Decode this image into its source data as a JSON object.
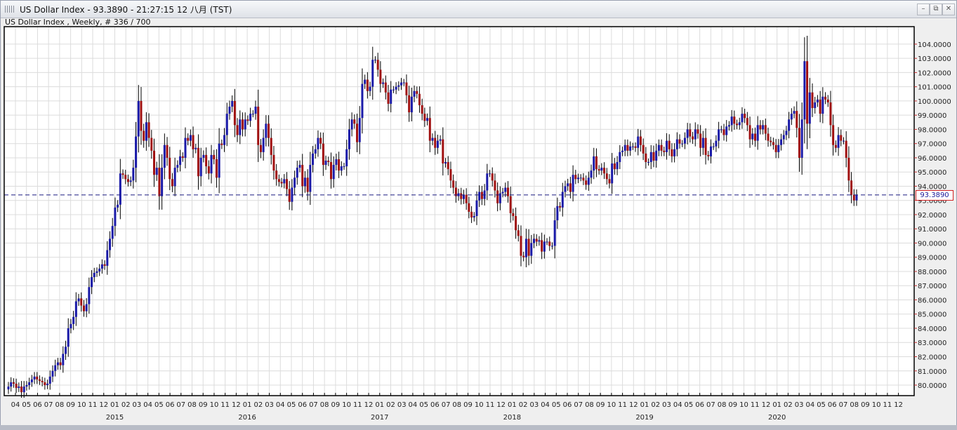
{
  "window": {
    "title": "US Dollar Index - 93.3890 - 21:27:15  12 八月 (TST)",
    "icon": "chart-grid-icon",
    "buttons": {
      "minimize": "–",
      "restore": "⧉",
      "close": "✕"
    }
  },
  "subtitle": "US Dollar Index , Weekly, # 336 / 700",
  "colors": {
    "up": "#1a1aa8",
    "down": "#a01010",
    "wick": "#000000",
    "current_line": "#1a1a80",
    "grid": "#dcdcdc"
  },
  "chart_data": {
    "type": "candlestick",
    "title": "US Dollar Index",
    "period": "Weekly",
    "current_price": 93.389,
    "current_price_label": "93.3890",
    "ylim": [
      79.26,
      105.23
    ],
    "y_ticks": [
      "80.0000",
      "81.0000",
      "82.0000",
      "83.0000",
      "84.0000",
      "85.0000",
      "86.0000",
      "87.0000",
      "88.0000",
      "89.0000",
      "90.0000",
      "91.0000",
      "92.0000",
      "93.0000",
      "94.0000",
      "95.0000",
      "96.0000",
      "97.0000",
      "98.0000",
      "99.0000",
      "100.0000",
      "101.0000",
      "102.0000",
      "103.0000",
      "104.0000"
    ],
    "month_labels": [
      "04",
      "05",
      "06",
      "07",
      "08",
      "09",
      "10",
      "11",
      "12",
      "01",
      "02",
      "03",
      "04",
      "05",
      "06",
      "07",
      "08",
      "09",
      "10",
      "11",
      "12",
      "01",
      "02",
      "03",
      "04",
      "05",
      "06",
      "07",
      "08",
      "09",
      "10",
      "11",
      "12",
      "01",
      "02",
      "03",
      "04",
      "05",
      "06",
      "07",
      "08",
      "09",
      "10",
      "11",
      "12",
      "01",
      "02",
      "03",
      "04",
      "05",
      "06",
      "07",
      "08",
      "09",
      "10",
      "11",
      "12",
      "01",
      "02",
      "03",
      "04",
      "05",
      "06",
      "07",
      "08",
      "09",
      "10",
      "11",
      "12",
      "01",
      "02",
      "03",
      "04",
      "05",
      "06",
      "07",
      "08",
      "09",
      "10",
      "11",
      "12"
    ],
    "year_labels": [
      "2015",
      "2016",
      "2017",
      "2018",
      "2019",
      "2020"
    ],
    "grid": true,
    "first_open": 79.7,
    "closes": [
      79.9,
      80.2,
      80.1,
      79.8,
      79.9,
      79.5,
      79.9,
      80.0,
      80.2,
      80.4,
      80.6,
      80.4,
      80.3,
      80.2,
      80.0,
      80.1,
      80.6,
      81.0,
      81.4,
      81.6,
      81.4,
      82.2,
      82.7,
      84.0,
      84.3,
      84.8,
      85.9,
      86.1,
      85.6,
      85.2,
      85.7,
      86.9,
      87.6,
      87.9,
      88.0,
      88.2,
      88.5,
      88.4,
      89.5,
      90.3,
      91.2,
      92.5,
      92.7,
      94.9,
      94.8,
      94.5,
      94.3,
      94.4,
      95.3,
      97.5,
      100.0,
      97.9,
      97.2,
      98.5,
      97.4,
      96.5,
      94.8,
      95.3,
      93.3,
      95.3,
      96.9,
      96.0,
      94.5,
      94.0,
      95.3,
      95.5,
      96.1,
      96.0,
      97.4,
      97.2,
      97.6,
      96.6,
      96.7,
      94.7,
      96.0,
      96.2,
      95.4,
      94.9,
      96.2,
      95.9,
      94.6,
      97.0,
      96.9,
      97.6,
      99.1,
      99.6,
      100.0,
      98.3,
      97.6,
      98.7,
      98.0,
      98.7,
      98.6,
      99.1,
      99.1,
      99.6,
      96.9,
      96.4,
      97.4,
      98.4,
      97.4,
      96.2,
      95.1,
      94.5,
      94.3,
      94.2,
      94.5,
      93.8,
      92.9,
      93.9,
      94.6,
      95.3,
      95.5,
      94.0,
      94.6,
      93.6,
      95.5,
      96.3,
      96.6,
      97.4,
      97.0,
      95.5,
      95.8,
      95.7,
      94.5,
      95.5,
      95.9,
      95.1,
      95.4,
      95.4,
      96.6,
      98.0,
      98.7,
      98.4,
      97.1,
      98.8,
      101.2,
      101.5,
      100.7,
      101.0,
      102.9,
      102.9,
      102.2,
      101.2,
      101.3,
      100.6,
      99.8,
      100.8,
      100.8,
      101.0,
      101.1,
      101.3,
      101.3,
      100.4,
      99.2,
      100.3,
      100.7,
      100.5,
      99.7,
      99.1,
      98.6,
      98.8,
      97.2,
      97.4,
      96.7,
      97.2,
      97.3,
      95.6,
      95.7,
      95.2,
      94.4,
      93.9,
      93.3,
      93.5,
      93.1,
      93.4,
      92.8,
      92.2,
      91.8,
      91.9,
      93.0,
      93.6,
      93.1,
      93.7,
      94.9,
      94.9,
      94.4,
      93.7,
      92.8,
      93.5,
      93.6,
      93.9,
      93.3,
      92.1,
      91.9,
      90.9,
      90.5,
      89.1,
      89.0,
      90.3,
      89.1,
      90.0,
      90.3,
      90.1,
      90.2,
      89.4,
      90.1,
      90.1,
      89.8,
      89.8,
      91.6,
      92.6,
      92.5,
      93.6,
      94.0,
      94.2,
      93.6,
      94.8,
      94.5,
      94.6,
      94.6,
      94.4,
      94.1,
      94.6,
      95.1,
      96.1,
      95.2,
      95.1,
      95.3,
      94.9,
      94.5,
      94.2,
      95.6,
      95.2,
      95.7,
      96.4,
      96.5,
      96.9,
      96.5,
      96.8,
      96.8,
      96.7,
      97.5,
      96.9,
      96.3,
      95.7,
      95.7,
      96.4,
      95.8,
      96.5,
      96.9,
      96.5,
      96.4,
      97.2,
      96.6,
      96.1,
      96.6,
      97.3,
      97.0,
      97.0,
      97.4,
      98.0,
      97.5,
      97.3,
      98.0,
      97.7,
      96.7,
      97.4,
      96.2,
      96.1,
      96.8,
      96.8,
      97.2,
      98.0,
      98.0,
      97.6,
      98.2,
      98.3,
      98.9,
      98.4,
      98.3,
      98.5,
      99.1,
      98.8,
      98.3,
      97.3,
      97.7,
      97.2,
      98.3,
      98.0,
      98.3,
      97.7,
      97.2,
      97.1,
      96.9,
      96.4,
      96.9,
      97.3,
      97.6,
      97.9,
      98.7,
      99.1,
      99.3,
      98.1,
      96.0,
      98.7,
      102.8,
      98.4,
      100.6,
      99.5,
      99.9,
      100.1,
      99.1,
      100.3,
      100.1,
      99.9,
      98.3,
      96.9,
      96.7,
      97.6,
      97.2,
      97.2,
      96.0,
      94.4,
      93.4,
      93.0,
      93.389
    ]
  }
}
